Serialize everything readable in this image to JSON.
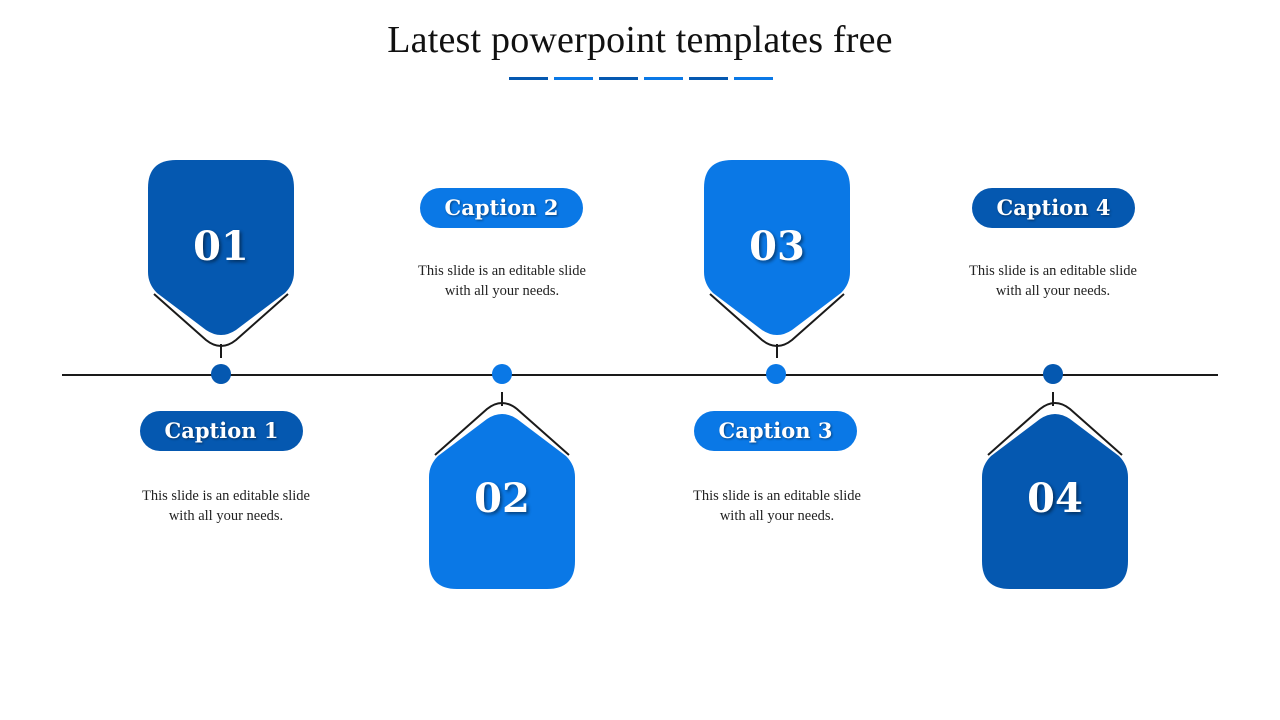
{
  "slide": {
    "title": "Latest powerpoint templates free",
    "colors": {
      "dark_blue": "#0558b0",
      "bright_blue": "#0a78e6",
      "line": "#1a1a1a",
      "text": "#222222"
    },
    "underline_colors": [
      "#0558b0",
      "#0a78e6",
      "#0558b0",
      "#0a78e6",
      "#0558b0",
      "#0a78e6"
    ],
    "steps": [
      {
        "number": "01",
        "caption": "Caption 1",
        "description": "This slide is an editable slide with all your needs.",
        "color": "#0558b0"
      },
      {
        "number": "02",
        "caption": "Caption 2",
        "description": "This slide is an editable slide with all your needs.",
        "color": "#0a78e6"
      },
      {
        "number": "03",
        "caption": "Caption 3",
        "description": "This slide is an editable slide with all your needs.",
        "color": "#0a78e6"
      },
      {
        "number": "04",
        "caption": "Caption 4",
        "description": "This slide is an editable slide with all your needs.",
        "color": "#0558b0"
      }
    ]
  }
}
